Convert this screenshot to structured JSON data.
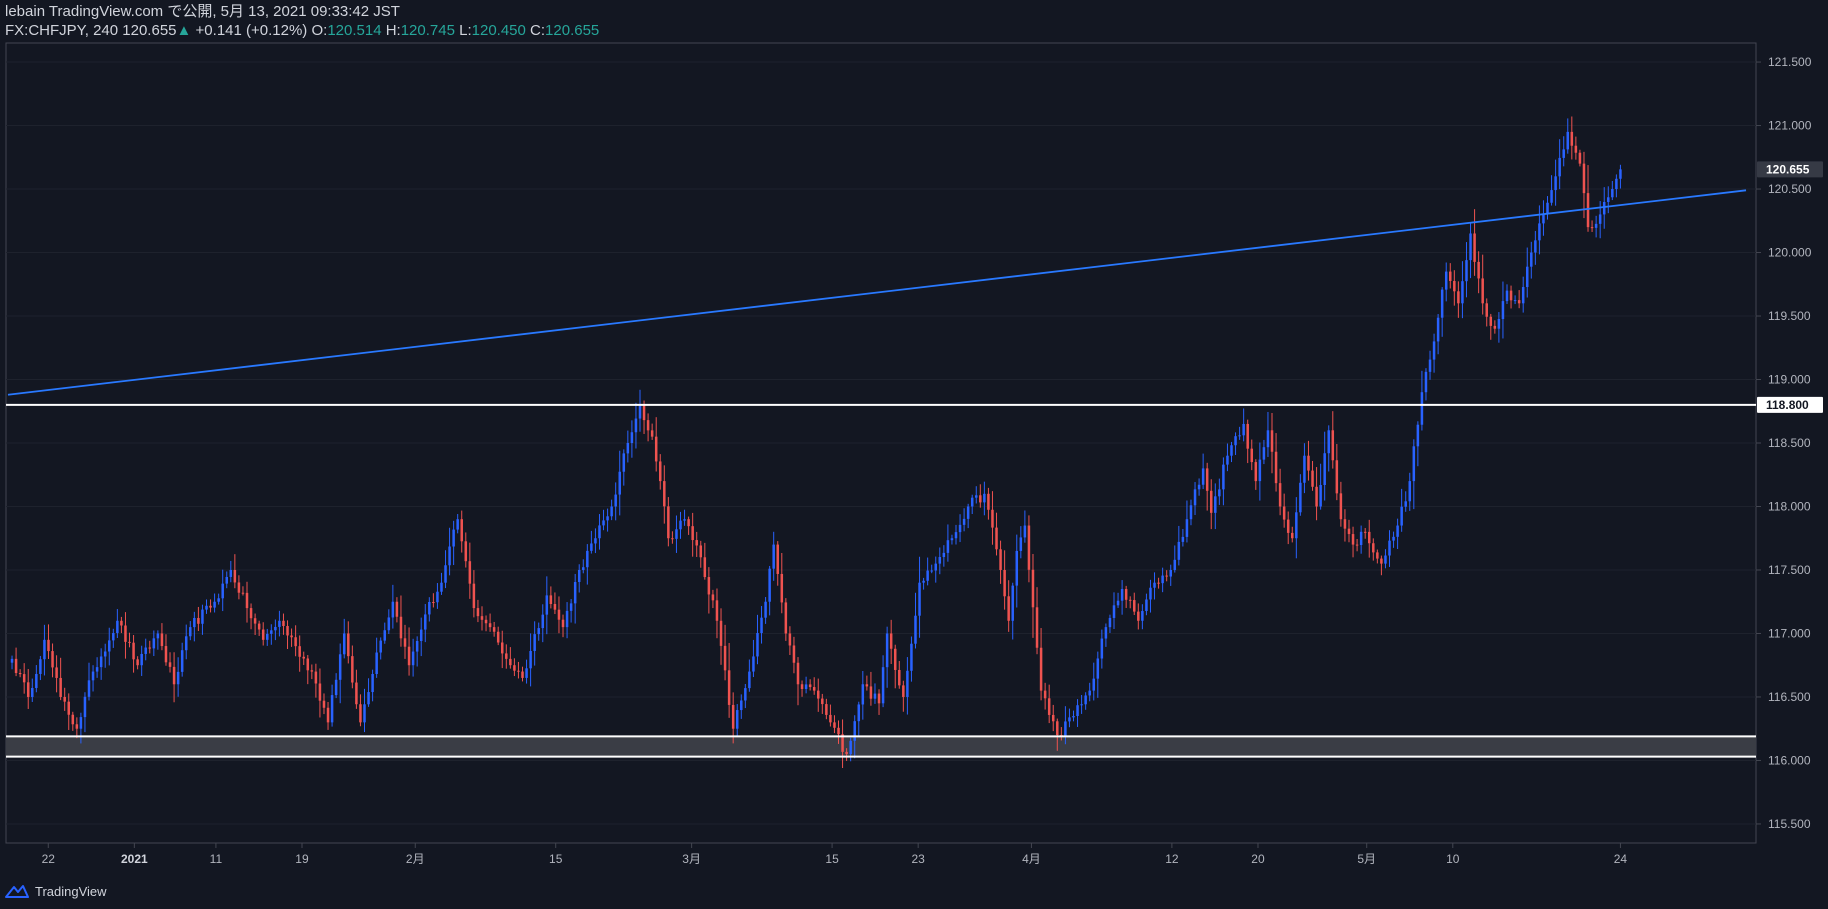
{
  "header": {
    "publisher": "lebain TradingView.com で公開, 5月 13, 2021 09:33:42 JST",
    "symbol": "FX:CHFJPY, 240",
    "last": "120.655",
    "change": "+0.141 (+0.12%)",
    "open_label": "O:",
    "open": "120.514",
    "high_label": "H:",
    "high": "120.745",
    "low_label": "L:",
    "low": "120.450",
    "close_label": "C:",
    "close": "120.655"
  },
  "footer": {
    "brand": "TradingView"
  },
  "colors": {
    "background": "#131722",
    "up": "#2962ff",
    "down": "#ef5350",
    "trendline": "#2979ff",
    "horizontal": "#ffffff",
    "zone_fill": "#3a3d45",
    "price_tag_bg": "#ffffff"
  },
  "chart_data": {
    "type": "candlestick",
    "symbol": "FX:CHFJPY",
    "timeframe": "240",
    "ylim": [
      115.35,
      121.65
    ],
    "y_ticks": [
      "115.500",
      "116.000",
      "116.500",
      "117.000",
      "117.500",
      "118.000",
      "118.500",
      "119.000",
      "119.500",
      "120.000",
      "120.500",
      "121.000",
      "121.500"
    ],
    "x_ticks": [
      {
        "label": "22",
        "bold": false
      },
      {
        "label": "2021",
        "bold": true
      },
      {
        "label": "11",
        "bold": false
      },
      {
        "label": "19",
        "bold": false
      },
      {
        "label": "2月",
        "bold": false
      },
      {
        "label": "15",
        "bold": false
      },
      {
        "label": "3月",
        "bold": false
      },
      {
        "label": "15",
        "bold": false
      },
      {
        "label": "23",
        "bold": false
      },
      {
        "label": "4月",
        "bold": false
      },
      {
        "label": "12",
        "bold": false
      },
      {
        "label": "20",
        "bold": false
      },
      {
        "label": "5月",
        "bold": false
      },
      {
        "label": "10",
        "bold": false
      },
      {
        "label": "24",
        "bold": false
      }
    ],
    "anchors": [
      [
        0,
        116.8
      ],
      [
        4,
        116.5
      ],
      [
        8,
        116.95
      ],
      [
        12,
        116.5
      ],
      [
        16,
        116.25
      ],
      [
        20,
        116.7
      ],
      [
        26,
        117.1
      ],
      [
        31,
        116.75
      ],
      [
        36,
        117.0
      ],
      [
        40,
        116.6
      ],
      [
        44,
        117.05
      ],
      [
        50,
        117.25
      ],
      [
        54,
        117.5
      ],
      [
        58,
        117.2
      ],
      [
        62,
        116.95
      ],
      [
        66,
        117.1
      ],
      [
        70,
        116.9
      ],
      [
        74,
        116.7
      ],
      [
        78,
        116.3
      ],
      [
        82,
        117.0
      ],
      [
        86,
        116.3
      ],
      [
        90,
        116.85
      ],
      [
        94,
        117.25
      ],
      [
        98,
        116.75
      ],
      [
        102,
        117.15
      ],
      [
        106,
        117.4
      ],
      [
        110,
        117.9
      ],
      [
        114,
        117.2
      ],
      [
        118,
        117.05
      ],
      [
        122,
        116.8
      ],
      [
        126,
        116.65
      ],
      [
        132,
        117.3
      ],
      [
        136,
        117.05
      ],
      [
        140,
        117.5
      ],
      [
        144,
        117.75
      ],
      [
        148,
        118.0
      ],
      [
        152,
        118.5
      ],
      [
        155,
        118.8
      ],
      [
        158,
        118.55
      ],
      [
        160,
        118.2
      ],
      [
        162,
        117.75
      ],
      [
        166,
        117.9
      ],
      [
        170,
        117.6
      ],
      [
        174,
        117.1
      ],
      [
        178,
        116.25
      ],
      [
        182,
        116.7
      ],
      [
        186,
        117.25
      ],
      [
        188,
        117.7
      ],
      [
        191,
        117.0
      ],
      [
        194,
        116.6
      ],
      [
        198,
        116.55
      ],
      [
        202,
        116.3
      ],
      [
        206,
        116.05
      ],
      [
        210,
        116.6
      ],
      [
        214,
        116.45
      ],
      [
        216,
        117.0
      ],
      [
        220,
        116.5
      ],
      [
        224,
        117.4
      ],
      [
        228,
        117.55
      ],
      [
        232,
        117.75
      ],
      [
        236,
        118.0
      ],
      [
        240,
        118.1
      ],
      [
        244,
        117.5
      ],
      [
        246,
        117.1
      ],
      [
        248,
        117.65
      ],
      [
        250,
        117.85
      ],
      [
        254,
        116.55
      ],
      [
        258,
        116.2
      ],
      [
        262,
        116.35
      ],
      [
        266,
        116.55
      ],
      [
        270,
        117.05
      ],
      [
        274,
        117.35
      ],
      [
        278,
        117.1
      ],
      [
        282,
        117.4
      ],
      [
        286,
        117.5
      ],
      [
        290,
        117.9
      ],
      [
        294,
        118.3
      ],
      [
        296,
        117.95
      ],
      [
        300,
        118.4
      ],
      [
        304,
        118.65
      ],
      [
        307,
        118.2
      ],
      [
        310,
        118.6
      ],
      [
        313,
        118.0
      ],
      [
        316,
        117.75
      ],
      [
        319,
        118.4
      ],
      [
        322,
        118.0
      ],
      [
        325,
        118.6
      ],
      [
        328,
        117.9
      ],
      [
        331,
        117.7
      ],
      [
        334,
        117.8
      ],
      [
        338,
        117.55
      ],
      [
        342,
        117.85
      ],
      [
        345,
        118.2
      ],
      [
        348,
        118.9
      ],
      [
        351,
        119.3
      ],
      [
        354,
        119.85
      ],
      [
        357,
        119.6
      ],
      [
        360,
        120.15
      ],
      [
        363,
        119.6
      ],
      [
        366,
        119.4
      ],
      [
        369,
        119.7
      ],
      [
        372,
        119.6
      ],
      [
        375,
        120.0
      ],
      [
        378,
        120.3
      ],
      [
        381,
        120.6
      ],
      [
        384,
        120.95
      ],
      [
        387,
        120.7
      ],
      [
        389,
        120.2
      ],
      [
        392,
        120.3
      ],
      [
        395,
        120.5
      ],
      [
        397,
        120.655
      ]
    ],
    "total_slots": 428,
    "trendline": {
      "from": [
        -1,
        118.88
      ],
      "to": [
        428,
        120.49
      ]
    },
    "horizontal_lines": [
      {
        "value": 118.8,
        "label": "118.800"
      },
      {
        "value": 116.19
      },
      {
        "value": 116.03
      }
    ],
    "zone": {
      "top": 116.19,
      "bottom": 116.03
    },
    "last_price": {
      "value": 120.655,
      "label": "120.655"
    }
  }
}
